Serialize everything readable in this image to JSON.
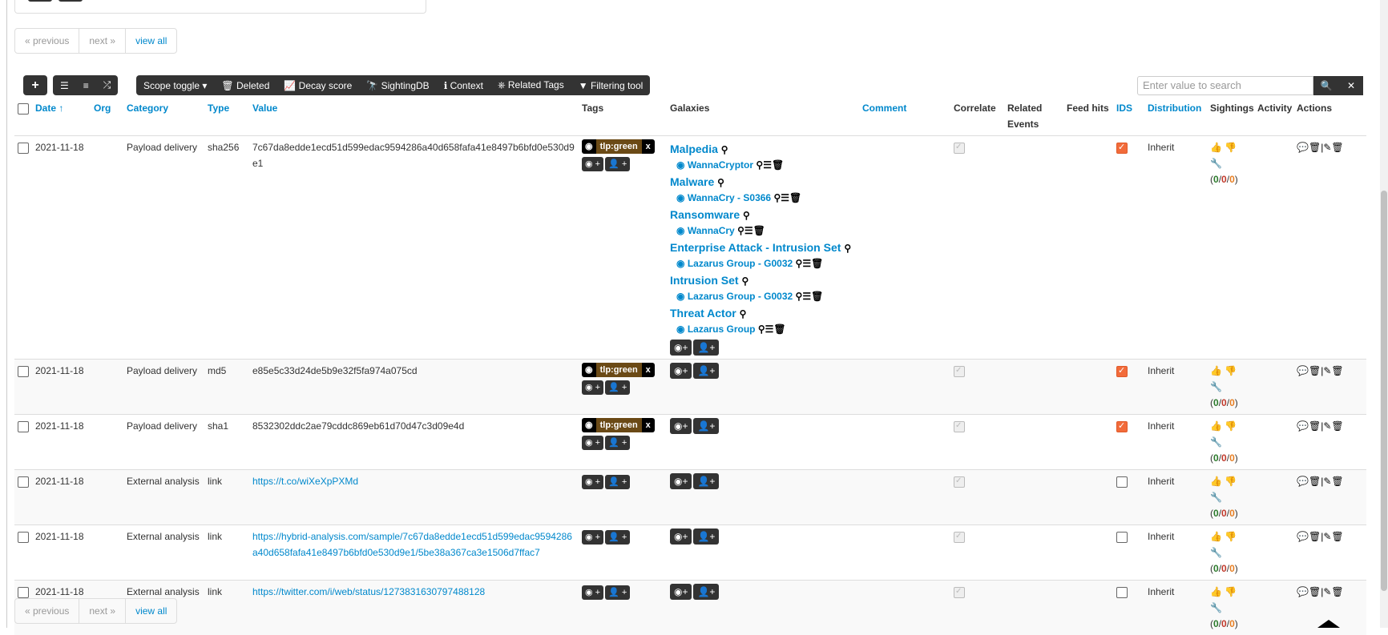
{
  "pager": {
    "previous": "« previous",
    "next": "next »",
    "view_all": "view all"
  },
  "toolbar": {
    "add": "+",
    "list1": "☰",
    "list2": "≡",
    "shuffle": "⤮",
    "scope_toggle": "Scope toggle ▾",
    "deleted": "Deleted",
    "decay_score": "Decay score",
    "sightingdb": "SightingDB",
    "context": "Context",
    "related_tags": "Related Tags",
    "filtering_tool": "Filtering tool"
  },
  "search": {
    "placeholder": "Enter value to search"
  },
  "columns": [
    "Date ↑",
    "Org",
    "Category",
    "Type",
    "Value",
    "Tags",
    "Galaxies",
    "Comment",
    "Correlate",
    "Related Events",
    "Feed hits",
    "IDS",
    "Distribution",
    "Sightings",
    "Activity",
    "Actions"
  ],
  "rows": [
    {
      "date": "2021-11-18",
      "category": "Payload delivery",
      "type": "sha256",
      "value": "7c67da8edde1ecd51d599edac9594286a40d658fafa41e8497b6bfd0e530d9e1",
      "value_is_link": false,
      "tag": "tlp:green",
      "ids": true,
      "distribution": "Inherit",
      "sightings": "(0/0/0)"
    },
    {
      "date": "2021-11-18",
      "category": "Payload delivery",
      "type": "md5",
      "value": "e85e5c33d24de5b9e32f5fa974a075cd",
      "value_is_link": false,
      "tag": "tlp:green",
      "ids": true,
      "distribution": "Inherit",
      "sightings": "(0/0/0)"
    },
    {
      "date": "2021-11-18",
      "category": "Payload delivery",
      "type": "sha1",
      "value": "8532302ddc2ae79cddc869eb61d70d47c3d09e4d",
      "value_is_link": false,
      "tag": "tlp:green",
      "ids": true,
      "distribution": "Inherit",
      "sightings": "(0/0/0)"
    },
    {
      "date": "2021-11-18",
      "category": "External analysis",
      "type": "link",
      "value": "https://t.co/wiXeXpPXMd",
      "value_is_link": true,
      "tag": "",
      "ids": false,
      "distribution": "Inherit",
      "sightings": "(0/0/0)"
    },
    {
      "date": "2021-11-18",
      "category": "External analysis",
      "type": "link",
      "value": "https://hybrid-analysis.com/sample/7c67da8edde1ecd51d599edac9594286a40d658fafa41e8497b6bfd0e530d9e1/5be38a367ca3e1506d7ffac7",
      "value_is_link": true,
      "tag": "",
      "ids": false,
      "distribution": "Inherit",
      "sightings": "(0/0/0)"
    },
    {
      "date": "2021-11-18",
      "category": "External analysis",
      "type": "link",
      "value": "https://twitter.com/i/web/status/1273831630797488128",
      "value_is_link": true,
      "tag": "",
      "ids": false,
      "distribution": "Inherit",
      "sightings": "(0/0/0)"
    }
  ],
  "galaxies": [
    {
      "name": "Malpedia",
      "item": "WannaCryptor"
    },
    {
      "name": "Malware",
      "item": "WannaCry - S0366"
    },
    {
      "name": "Ransomware",
      "item": "WannaCry"
    },
    {
      "name": "Enterprise Attack - Intrusion Set",
      "item": "Lazarus Group - G0032"
    },
    {
      "name": "Intrusion Set",
      "item": "Lazarus Group - G0032"
    },
    {
      "name": "Threat Actor",
      "item": "Lazarus Group"
    }
  ],
  "icons": {
    "globe": "globe-icon",
    "user": "user-icon",
    "search": "search-icon",
    "list": "list-icon",
    "trash": "trash-icon",
    "thumbs_up": "thumbs-up-icon",
    "thumbs_down": "thumbs-down-icon",
    "wrench": "wrench-icon",
    "comment": "comment-icon",
    "edit": "edit-icon"
  },
  "colors": {
    "link": "#0088cc",
    "tlp_green": "#6b4a16",
    "ids_checked": "#f26b3a"
  }
}
